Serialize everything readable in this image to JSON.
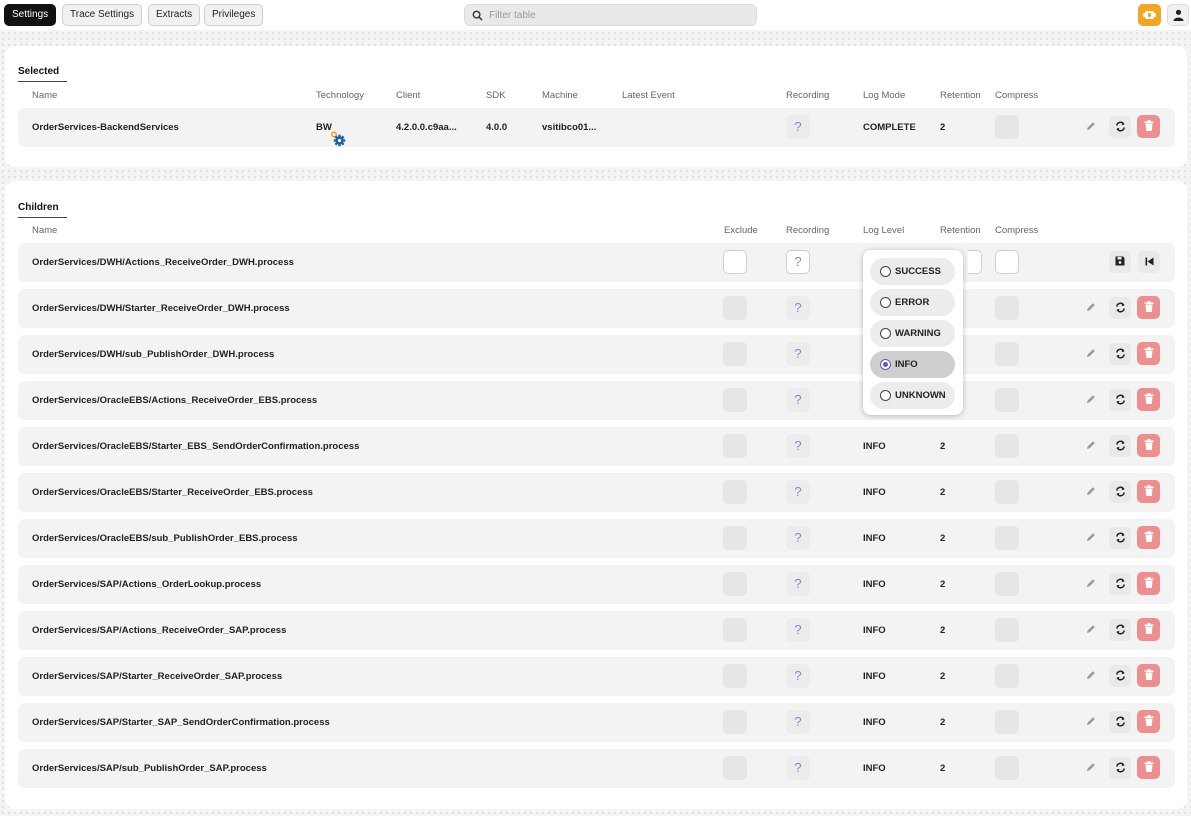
{
  "nav": {
    "tabs": [
      {
        "label": "Settings",
        "active": true
      },
      {
        "label": "Trace Settings",
        "active": false
      },
      {
        "label": "Extracts",
        "active": false
      },
      {
        "label": "Privileges",
        "active": false
      }
    ],
    "search_placeholder": "Filter table"
  },
  "selected": {
    "title": "Selected",
    "headers": {
      "name": "Name",
      "technology": "Technology",
      "client": "Client",
      "sdk": "SDK",
      "machine": "Machine",
      "latest_event": "Latest Event",
      "recording": "Recording",
      "log_mode": "Log Mode",
      "retention": "Retention",
      "compress": "Compress"
    },
    "row": {
      "name": "OrderServices-BackendServices",
      "technology": "BW",
      "client": "4.2.0.0.c9aa...",
      "sdk": "4.0.0",
      "machine": "vsitibco01...",
      "latest_event": "",
      "recording": "?",
      "log_mode": "COMPLETE",
      "retention": "2"
    }
  },
  "children": {
    "title": "Children",
    "headers": {
      "name": "Name",
      "exclude": "Exclude",
      "recording": "Recording",
      "log_level": "Log Level",
      "retention": "Retention",
      "compress": "Compress"
    },
    "rows": [
      {
        "name": "OrderServices/DWH/Actions_ReceiveOrder_DWH.process",
        "recording": "?",
        "log_level": "",
        "retention": "",
        "editing": true
      },
      {
        "name": "OrderServices/DWH/Starter_ReceiveOrder_DWH.process",
        "recording": "?",
        "log_level": "",
        "retention": ""
      },
      {
        "name": "OrderServices/DWH/sub_PublishOrder_DWH.process",
        "recording": "?",
        "log_level": "",
        "retention": ""
      },
      {
        "name": "OrderServices/OracleEBS/Actions_ReceiveOrder_EBS.process",
        "recording": "?",
        "log_level": "",
        "retention": ""
      },
      {
        "name": "OrderServices/OracleEBS/Starter_EBS_SendOrderConfirmation.process",
        "recording": "?",
        "log_level": "INFO",
        "retention": "2"
      },
      {
        "name": "OrderServices/OracleEBS/Starter_ReceiveOrder_EBS.process",
        "recording": "?",
        "log_level": "INFO",
        "retention": "2"
      },
      {
        "name": "OrderServices/OracleEBS/sub_PublishOrder_EBS.process",
        "recording": "?",
        "log_level": "INFO",
        "retention": "2"
      },
      {
        "name": "OrderServices/SAP/Actions_OrderLookup.process",
        "recording": "?",
        "log_level": "INFO",
        "retention": "2"
      },
      {
        "name": "OrderServices/SAP/Actions_ReceiveOrder_SAP.process",
        "recording": "?",
        "log_level": "INFO",
        "retention": "2"
      },
      {
        "name": "OrderServices/SAP/Starter_ReceiveOrder_SAP.process",
        "recording": "?",
        "log_level": "INFO",
        "retention": "2"
      },
      {
        "name": "OrderServices/SAP/Starter_SAP_SendOrderConfirmation.process",
        "recording": "?",
        "log_level": "INFO",
        "retention": "2"
      },
      {
        "name": "OrderServices/SAP/sub_PublishOrder_SAP.process",
        "recording": "?",
        "log_level": "INFO",
        "retention": "2"
      }
    ]
  },
  "log_level_dropdown": {
    "options": [
      {
        "label": "SUCCESS",
        "selected": false
      },
      {
        "label": "ERROR",
        "selected": false
      },
      {
        "label": "WARNING",
        "selected": false
      },
      {
        "label": "INFO",
        "selected": true
      },
      {
        "label": "UNKNOWN",
        "selected": false
      }
    ]
  },
  "colors": {
    "accent_dark": "#111111",
    "delete_button": "#ee8f8f",
    "plugin_button": "#f5a524",
    "question_mark": "#8a7fd8",
    "radio_selected": "#5a5acf",
    "tech_icon_blue": "#1f5fa8",
    "tech_icon_orange": "#f39c12"
  },
  "icons": {
    "search": "search-icon",
    "plugin": "plugin-icon",
    "user": "user-icon",
    "technology": "gear-icon",
    "edit": "pencil-icon",
    "refresh": "refresh-icon",
    "delete": "trash-icon",
    "save": "save-icon",
    "revert": "skip-back-icon"
  }
}
